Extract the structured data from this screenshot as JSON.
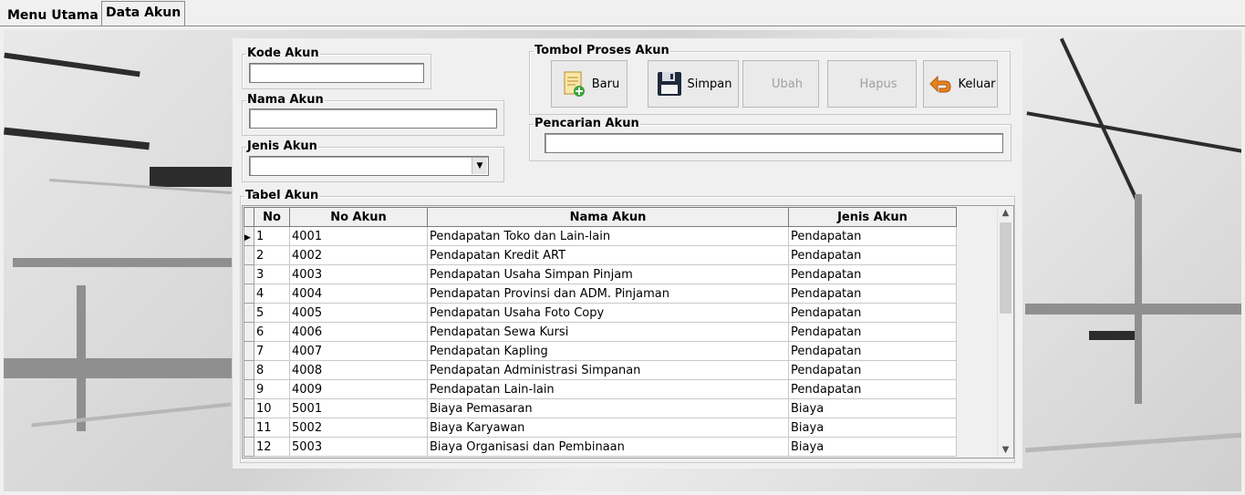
{
  "tabs": [
    {
      "label": "Menu Utama",
      "active": false
    },
    {
      "label": "Data Akun",
      "active": true
    }
  ],
  "form": {
    "kode_akun": {
      "label": "Kode Akun",
      "value": ""
    },
    "nama_akun": {
      "label": "Nama Akun",
      "value": ""
    },
    "jenis_akun": {
      "label": "Jenis Akun",
      "selected": ""
    }
  },
  "tombol": {
    "title": "Tombol Proses Akun",
    "buttons": [
      {
        "label": "Baru",
        "icon": "new-document-icon",
        "enabled": true
      },
      {
        "label": "Simpan",
        "icon": "floppy-disk-icon",
        "enabled": true
      },
      {
        "label": "Ubah",
        "icon": "edit-icon",
        "enabled": false
      },
      {
        "label": "Hapus",
        "icon": "delete-icon",
        "enabled": false
      },
      {
        "label": "Keluar",
        "icon": "exit-arrow-icon",
        "enabled": true
      }
    ]
  },
  "pencarian": {
    "label": "Pencarian Akun",
    "value": ""
  },
  "tabel": {
    "title": "Tabel Akun",
    "columns": [
      "No",
      "No Akun",
      "Nama Akun",
      "Jenis Akun"
    ],
    "rows": [
      [
        "1",
        "4001",
        "Pendapatan Toko dan Lain-lain",
        "Pendapatan"
      ],
      [
        "2",
        "4002",
        "Pendapatan Kredit ART",
        "Pendapatan"
      ],
      [
        "3",
        "4003",
        "Pendapatan Usaha Simpan Pinjam",
        "Pendapatan"
      ],
      [
        "4",
        "4004",
        "Pendapatan Provinsi dan ADM. Pinjaman",
        "Pendapatan"
      ],
      [
        "5",
        "4005",
        "Pendapatan Usaha Foto Copy",
        "Pendapatan"
      ],
      [
        "6",
        "4006",
        "Pendapatan Sewa Kursi",
        "Pendapatan"
      ],
      [
        "7",
        "4007",
        "Pendapatan Kapling",
        "Pendapatan"
      ],
      [
        "8",
        "4008",
        "Pendapatan Administrasi Simpanan",
        "Pendapatan"
      ],
      [
        "9",
        "4009",
        "Pendapatan Lain-lain",
        "Pendapatan"
      ],
      [
        "10",
        "5001",
        "Biaya Pemasaran",
        "Biaya"
      ],
      [
        "11",
        "5002",
        "Biaya Karyawan",
        "Biaya"
      ],
      [
        "12",
        "5003",
        "Biaya Organisasi dan Pembinaan",
        "Biaya"
      ]
    ]
  }
}
